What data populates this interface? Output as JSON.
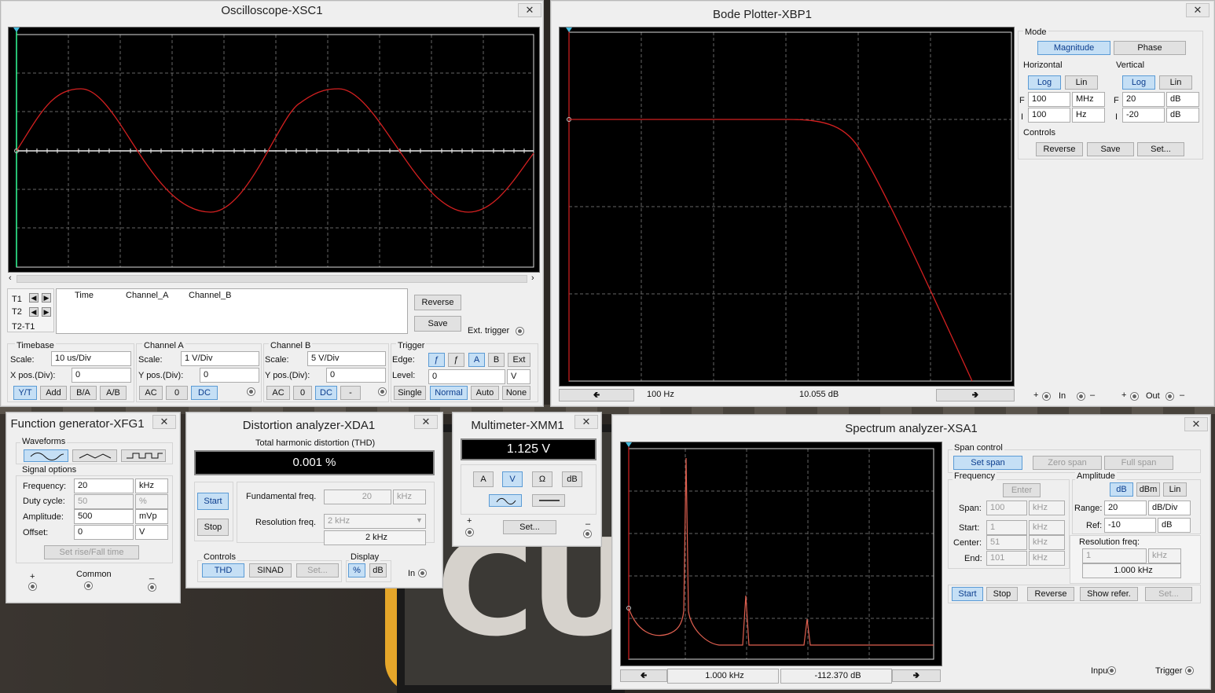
{
  "osc": {
    "title": "Oscilloscope-XSC1",
    "t1": "T1",
    "t2": "T2",
    "t2t1": "T2-T1",
    "col_time": "Time",
    "col_a": "Channel_A",
    "col_b": "Channel_B",
    "reverse": "Reverse",
    "save": "Save",
    "ext_trigger": "Ext. trigger",
    "timebase": {
      "label": "Timebase",
      "scale_label": "Scale:",
      "scale": "10 us/Div",
      "xpos_label": "X pos.(Div):",
      "xpos": "0",
      "yt": "Y/T",
      "add": "Add",
      "ba": "B/A",
      "ab": "A/B"
    },
    "cha": {
      "label": "Channel A",
      "scale_label": "Scale:",
      "scale": "1  V/Div",
      "ypos_label": "Y pos.(Div):",
      "ypos": "0",
      "ac": "AC",
      "zero": "0",
      "dc": "DC"
    },
    "chb": {
      "label": "Channel B",
      "scale_label": "Scale:",
      "scale": "5  V/Div",
      "ypos_label": "Y pos.(Div):",
      "ypos": "0",
      "ac": "AC",
      "zero": "0",
      "dc": "DC",
      "minus": "-"
    },
    "trigger": {
      "label": "Trigger",
      "edge_label": "Edge:",
      "rise": "ƒ",
      "fall": "ƒ",
      "a": "A",
      "b": "B",
      "ext": "Ext",
      "level_label": "Level:",
      "level": "0",
      "unit": "V",
      "single": "Single",
      "normal": "Normal",
      "auto": "Auto",
      "none": "None"
    }
  },
  "bode": {
    "title": "Bode Plotter-XBP1",
    "mode_label": "Mode",
    "magnitude": "Magnitude",
    "phase": "Phase",
    "horizontal": "Horizontal",
    "vertical": "Vertical",
    "log": "Log",
    "lin": "Lin",
    "hf_label": "F",
    "hf": "100",
    "hf_unit": "MHz",
    "hi_label": "I",
    "hi": "100",
    "hi_unit": "Hz",
    "vf_label": "F",
    "vf": "20",
    "vf_unit": "dB",
    "vi_label": "I",
    "vi": "-20",
    "vi_unit": "dB",
    "controls": "Controls",
    "reverse": "Reverse",
    "save": "Save",
    "set": "Set...",
    "readout_freq": "100  Hz",
    "readout_val": "10.055 dB",
    "plus": "+",
    "minus": "–",
    "in": "In",
    "out": "Out"
  },
  "fg": {
    "title": "Function generator-XFG1",
    "waveforms": "Waveforms",
    "signal_options": "Signal options",
    "freq_label": "Frequency:",
    "freq": "20",
    "freq_unit": "kHz",
    "duty_label": "Duty cycle:",
    "duty": "50",
    "duty_unit": "%",
    "amp_label": "Amplitude:",
    "amp": "500",
    "amp_unit": "mVp",
    "offset_label": "Offset:",
    "offset": "0",
    "offset_unit": "V",
    "rise_fall": "Set rise/Fall time",
    "plus": "+",
    "common": "Common",
    "minus": "_"
  },
  "da": {
    "title": "Distortion analyzer-XDA1",
    "thd_label": "Total harmonic distortion (THD)",
    "thd": "0.001 %",
    "start": "Start",
    "stop": "Stop",
    "fund_label": "Fundamental freq.",
    "fund": "20",
    "fund_unit": "kHz",
    "res_label": "Resolution freq.",
    "res": "2 kHz",
    "res_val": "2 kHz",
    "controls": "Controls",
    "thd_btn": "THD",
    "sinad": "SINAD",
    "set": "Set...",
    "display": "Display",
    "pct": "%",
    "db": "dB",
    "in": "In"
  },
  "mm": {
    "title": "Multimeter-XMM1",
    "reading": "1.125 V",
    "a": "A",
    "v": "V",
    "ohm": "Ω",
    "db": "dB",
    "set": "Set...",
    "plus": "+",
    "minus": "–"
  },
  "sa": {
    "title": "Spectrum analyzer-XSA1",
    "span_control": "Span control",
    "set_span": "Set span",
    "zero_span": "Zero span",
    "full_span": "Full span",
    "frequency": "Frequency",
    "enter": "Enter",
    "span_label": "Span:",
    "span": "100",
    "span_unit": "kHz",
    "start_label": "Start:",
    "start": "1",
    "start_unit": "kHz",
    "center_label": "Center:",
    "center": "51",
    "center_unit": "kHz",
    "end_label": "End:",
    "end": "101",
    "end_unit": "kHz",
    "amplitude": "Amplitude",
    "db": "dB",
    "dbm": "dBm",
    "lin": "Lin",
    "range_label": "Range:",
    "range": "20",
    "range_unit": "dB/Div",
    "ref_label": "Ref:",
    "ref": "-10",
    "ref_unit": "dB",
    "res_label": "Resolution freq:",
    "res": "1",
    "res_unit": "kHz",
    "res_val": "1.000 kHz",
    "start_btn": "Start",
    "stop_btn": "Stop",
    "reverse": "Reverse",
    "show_ref": "Show refer.",
    "set": "Set...",
    "readout_freq": "1.000 kHz",
    "readout_val": "-112.370  dB",
    "input": "Input",
    "trigger": "Trigger"
  },
  "close": "✕",
  "bg_text": "CU"
}
